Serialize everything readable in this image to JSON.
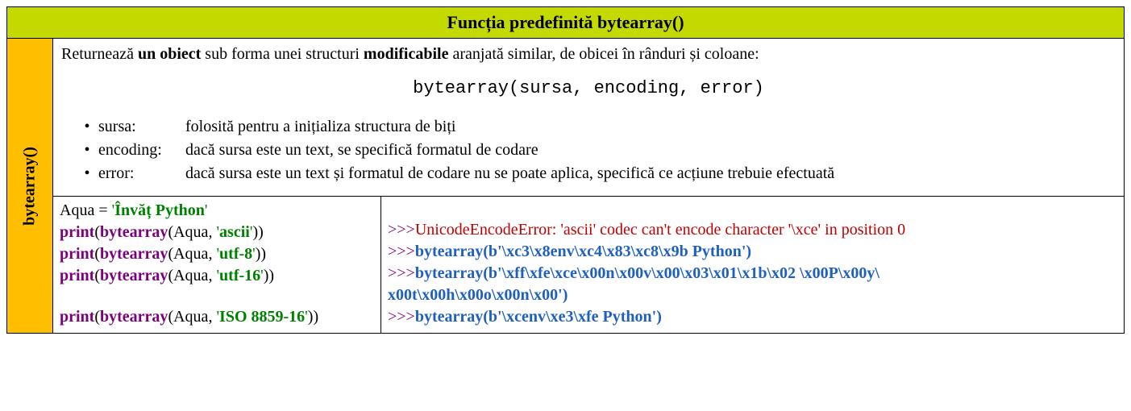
{
  "header": {
    "title": "Funcția predefinită bytearray()"
  },
  "sidebar": {
    "label": "bytearray()"
  },
  "desc": {
    "pre": "Returnează ",
    "b1": "un obiect",
    "mid": " sub forma unei structuri ",
    "b2": "modificabile",
    "post": " aranjată similar, de obicei în rânduri și coloane:"
  },
  "syntax": "bytearray(sursa, encoding, error)",
  "params": [
    {
      "name": "sursa:",
      "desc": "folosită pentru a inițializa structura de biți"
    },
    {
      "name": "encoding:",
      "desc": "dacă sursa este un text, se specifică formatul de codare"
    },
    {
      "name": "error:",
      "desc": "dacă sursa este un text și formatul de codare nu se poate aplica, specifică ce acțiune trebuie efectuată"
    }
  ],
  "code": {
    "var": "Aqua",
    "eq": " = ",
    "q": "'",
    "strlit": "Învăț Python",
    "print": "print",
    "fn": "bytearray",
    "open": "(",
    "close": ")",
    "close2": "))",
    "comma": ", ",
    "enc1": "ascii",
    "enc2": "utf-8",
    "enc3": "utf-16",
    "enc4": "ISO 8859-16"
  },
  "out": {
    "prompt": ">>>",
    "err": "UnicodeEncodeError: 'ascii' codec can't encode character '\\xce' in position 0",
    "l2": "bytearray(b'\\xc3\\x8env\\xc4\\x83\\xc8\\x9b Python')",
    "l3a": "bytearray(b'\\xff\\xfe\\xce\\x00n\\x00v\\x00\\x03\\x01\\x1b\\x02 \\x00P\\x00y\\",
    "l3b": "x00t\\x00h\\x00o\\x00n\\x00')",
    "l4": "bytearray(b'\\xcenv\\xe3\\xfe Python')"
  }
}
